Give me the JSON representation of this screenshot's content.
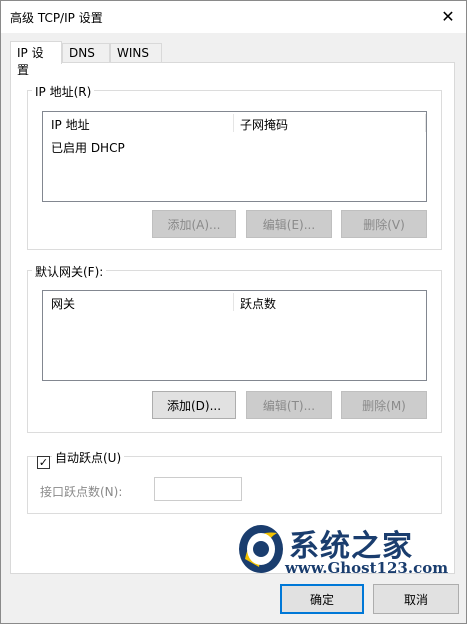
{
  "window": {
    "title": "高级 TCP/IP 设置"
  },
  "tabs": [
    {
      "label": "IP 设置",
      "active": true
    },
    {
      "label": "DNS",
      "active": false
    },
    {
      "label": "WINS",
      "active": false
    }
  ],
  "ip_address_group": {
    "label": "IP 地址(R)",
    "columns": [
      "IP 地址",
      "子网掩码"
    ],
    "rows": [
      [
        "已启用 DHCP",
        ""
      ]
    ],
    "buttons": {
      "add": "添加(A)...",
      "edit": "编辑(E)...",
      "remove": "删除(V)"
    }
  },
  "gateway_group": {
    "label": "默认网关(F):",
    "columns": [
      "网关",
      "跃点数"
    ],
    "rows": [],
    "buttons": {
      "add": "添加(D)...",
      "edit": "编辑(T)...",
      "remove": "删除(M)"
    }
  },
  "metric_group": {
    "auto_metric_label": "自动跃点(U)",
    "auto_metric_checked": true,
    "interface_metric_label": "接口跃点数(N):",
    "interface_metric_value": ""
  },
  "footer": {
    "ok_label": "确定",
    "cancel_label": "取消"
  },
  "watermark": {
    "text": "系统之家",
    "url": "www.Ghost123.com"
  },
  "icons": {
    "close": "close-icon",
    "check": "checkmark-icon",
    "logo": "ghost-logo-icon"
  },
  "colors": {
    "accent": "#0078d7",
    "logo": "#1a3d6e"
  }
}
